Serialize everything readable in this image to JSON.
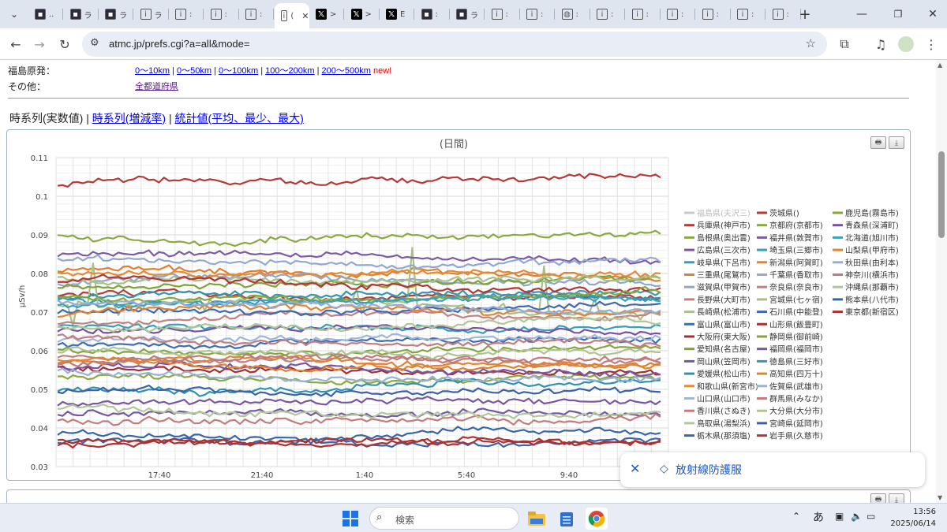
{
  "tabs": [
    {
      "label": "..",
      "icon": "dark-square-icon"
    },
    {
      "label": "ラ",
      "icon": "dark-square-icon"
    },
    {
      "label": "ラ",
      "icon": "dark-square-icon"
    },
    {
      "label": "ラ",
      "icon": "circle-info-icon"
    },
    {
      "label": ":",
      "icon": "circle-info-icon"
    },
    {
      "label": ":",
      "icon": "circle-info-icon"
    },
    {
      "label": ":",
      "icon": "circle-info-icon"
    },
    {
      "label": "(",
      "icon": "circle-info-icon",
      "active": true
    },
    {
      "label": ">",
      "icon": "x-logo-icon"
    },
    {
      "label": ">",
      "icon": "x-logo-icon"
    },
    {
      "label": "E",
      "icon": "x-logo-icon"
    },
    {
      "label": ":",
      "icon": "dark-square-icon"
    },
    {
      "label": "ラ",
      "icon": "dark-square-icon"
    },
    {
      "label": ":",
      "icon": "circle-info-icon"
    },
    {
      "label": ":",
      "icon": "circle-info-icon"
    },
    {
      "label": ":",
      "icon": "globe-icon"
    },
    {
      "label": ":",
      "icon": "circle-info-icon"
    },
    {
      "label": ":",
      "icon": "circle-info-icon"
    },
    {
      "label": ":",
      "icon": "circle-info-icon"
    },
    {
      "label": ":",
      "icon": "circle-info-icon"
    },
    {
      "label": ":",
      "icon": "circle-info-icon"
    },
    {
      "label": ":",
      "icon": "circle-info-icon"
    }
  ],
  "url": "atmc.jp/prefs.cgi?a=all&mode=",
  "header": {
    "fukushima_label": "福島原発：",
    "other_label": "その他：",
    "range_links": [
      "0〜10km",
      "0〜50km",
      "0〜100km",
      "100〜200km",
      "200〜500km"
    ],
    "new_badge": "new!",
    "other_link": "全都道府県"
  },
  "mode_links": {
    "current": "時系列(実数値)",
    "rate": "時系列(増減率)",
    "stats": "統計値(平均、最少、最大)"
  },
  "chart_data": {
    "type": "line",
    "title": "(日間)",
    "ylabel": "μSv/h",
    "ylim": [
      0.03,
      0.11
    ],
    "y_ticks": [
      "0.11",
      "0.1",
      "0.09",
      "0.08",
      "0.07",
      "0.06",
      "0.05",
      "0.04",
      "0.03"
    ],
    "x_ticks": [
      "17:40",
      "21:40",
      "1:40",
      "5:40",
      "9:40"
    ],
    "grid": true,
    "legend_position": "right",
    "series": [
      {
        "name": "福島県(夫沢三)",
        "color": "#c8c8c8",
        "base": null
      },
      {
        "name": "兵庫県(神戸市)",
        "color": "#b63b3b",
        "base": 0.0745
      },
      {
        "name": "島根県(奥出雲)",
        "color": "#8aaa3c",
        "base": 0.053
      },
      {
        "name": "広島県(三次市)",
        "color": "#7a55a0",
        "base": 0.0465
      },
      {
        "name": "岐阜県(下呂市)",
        "color": "#3a9bb5",
        "base": 0.073
      },
      {
        "name": "三重県(尾鷲市)",
        "color": "#e07f2e",
        "base": 0.081
      },
      {
        "name": "滋賀県(甲賀市)",
        "color": "#8ea6d0",
        "base": 0.077
      },
      {
        "name": "長野県(大町市)",
        "color": "#c08080",
        "base": 0.059
      },
      {
        "name": "長崎県(松浦市)",
        "color": "#a8c188",
        "base": 0.072
      },
      {
        "name": "富山県(富山市)",
        "color": "#3d6db5",
        "base": 0.062
      },
      {
        "name": "大阪府(東大阪)",
        "color": "#a33030",
        "base": 0.0555
      },
      {
        "name": "愛知県(名古屋)",
        "color": "#7fa23a",
        "base": 0.0765
      },
      {
        "name": "岡山県(笠岡市)",
        "color": "#7358a3",
        "base": 0.0435
      },
      {
        "name": "愛媛県(松山市)",
        "color": "#2f93ad",
        "base": 0.05
      },
      {
        "name": "和歌山県(新宮市)",
        "color": "#e58a35",
        "base": 0.08
      },
      {
        "name": "山口県(山口市)",
        "color": "#9fb6d8",
        "base": 0.0625
      },
      {
        "name": "香川県(さぬき)",
        "color": "#c47c7c",
        "base": 0.042
      },
      {
        "name": "鳥取県(湯梨浜)",
        "color": "#b2c79a",
        "base": 0.0455
      },
      {
        "name": "栃木県(那須塩)",
        "color": "#3c64a8",
        "base": 0.036
      },
      {
        "name": "茨城県()",
        "color": "#b83838",
        "base": 0.103
      },
      {
        "name": "京都府(京都市)",
        "color": "#89aa40",
        "base": 0.0895
      },
      {
        "name": "福井県(敦賀市)",
        "color": "#7d5aa6",
        "base": 0.085
      },
      {
        "name": "埼玉県(三郷市)",
        "color": "#35a0b8",
        "base": 0.066
      },
      {
        "name": "新潟県(阿賀町)",
        "color": "#e38333",
        "base": 0.058
      },
      {
        "name": "千葉県(香取市)",
        "color": "#90a8d2",
        "base": 0.0835
      },
      {
        "name": "奈良県(奈良市)",
        "color": "#c28282",
        "base": 0.0675
      },
      {
        "name": "宮城県(七ヶ宿)",
        "color": "#a6c085",
        "base": 0.079
      },
      {
        "name": "石川県(中能登)",
        "color": "#4169b0",
        "base": 0.07
      },
      {
        "name": "山形県(飯豊町)",
        "color": "#a83333",
        "base": 0.0365
      },
      {
        "name": "静岡県(御前崎)",
        "color": "#84a53e",
        "base": 0.0605
      },
      {
        "name": "福岡県(福岡市)",
        "color": "#7a57a2",
        "base": 0.056
      },
      {
        "name": "徳島県(三好市)",
        "color": "#3398b0",
        "base": 0.074
      },
      {
        "name": "高知県(四万十)",
        "color": "#e28231",
        "base": 0.0565
      },
      {
        "name": "佐賀県(武雄市)",
        "color": "#9bb2d6",
        "base": 0.055
      },
      {
        "name": "群馬県(みなか)",
        "color": "#c27e7e",
        "base": 0.064
      },
      {
        "name": "大分県(大分市)",
        "color": "#adc491",
        "base": 0.06
      },
      {
        "name": "宮崎県(延岡市)",
        "color": "#3a62a8",
        "base": 0.049
      },
      {
        "name": "岩手県(久慈市)",
        "color": "#b33535",
        "base": 0.078
      },
      {
        "name": "鹿児島(霧島市)",
        "color": "#86a83b",
        "base": 0.0735
      },
      {
        "name": "青森県(深浦町)",
        "color": "#7652a0",
        "base": 0.0655
      },
      {
        "name": "北海道(旭川市)",
        "color": "#3aa0bb",
        "base": 0.0715
      },
      {
        "name": "山梨県(甲府市)",
        "color": "#e18432",
        "base": 0.069
      },
      {
        "name": "秋田県(由利本)",
        "color": "#95add4",
        "base": 0.0725
      },
      {
        "name": "神奈川(横浜市)",
        "color": "#c07a7a",
        "base": 0.057
      },
      {
        "name": "沖縄県(那覇市)",
        "color": "#b0c697",
        "base": 0.066
      },
      {
        "name": "熊本県(八代市)",
        "color": "#3766ab",
        "base": 0.0385
      },
      {
        "name": "東京都(新宿区)",
        "color": "#b03030",
        "base": 0.035
      }
    ]
  },
  "toast": {
    "text": "放射線防護服"
  },
  "taskbar": {
    "search_placeholder": "検索",
    "ime": "あ",
    "time": "13:56",
    "date": "2025/06/14"
  }
}
